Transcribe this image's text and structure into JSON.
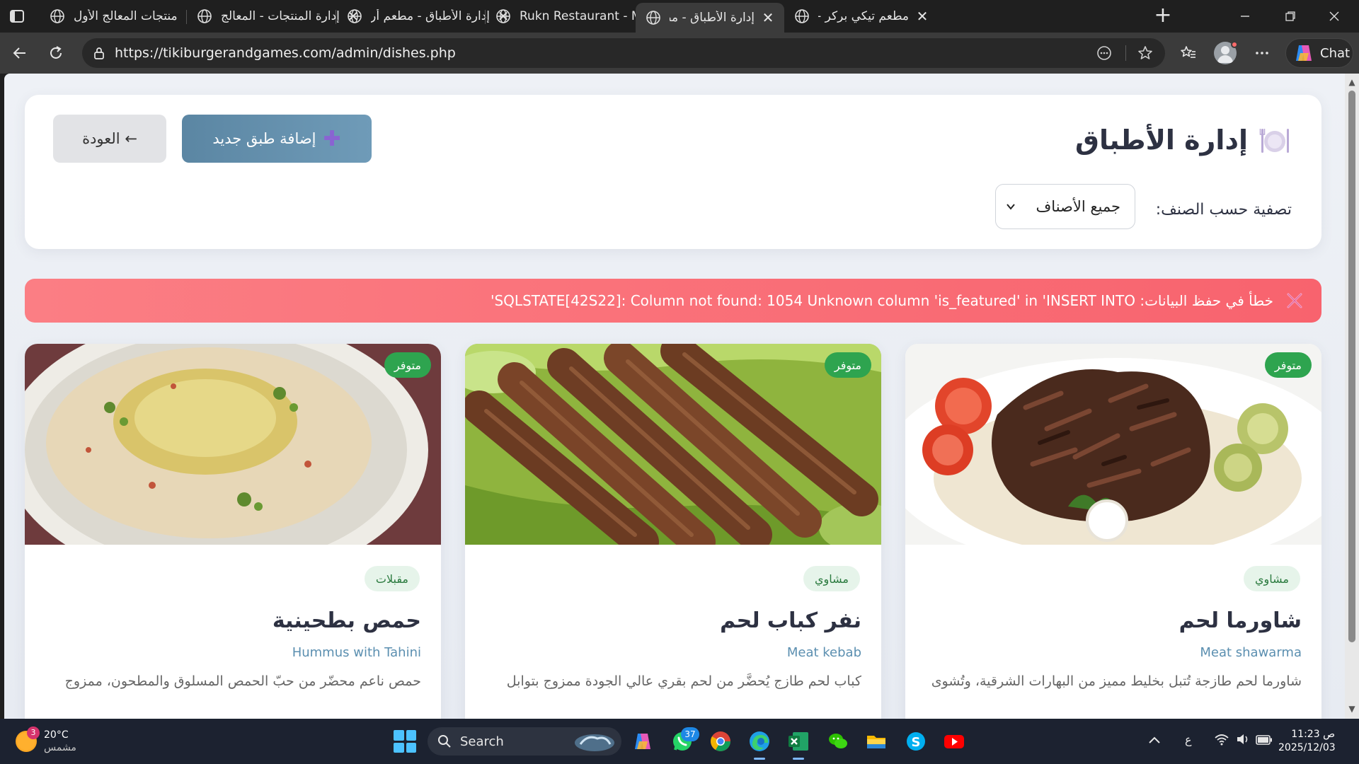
{
  "browser": {
    "tabs": [
      {
        "title": "منتجات المعالج الأول",
        "active": false
      },
      {
        "title": "إدارة المنتجات - المعالج",
        "active": false
      },
      {
        "title": "إدارة الأطباق - مطعم أرز",
        "active": false
      },
      {
        "title": "Rukn Restaurant - Menu",
        "active": false
      },
      {
        "title": "إدارة الأطباق - مطعم أرز",
        "active": true
      },
      {
        "title": "مطعم تيكي بركر - Menu",
        "active": false
      }
    ],
    "url": "https://tikiburgerandgames.com/admin/dishes.php",
    "chat_label": "Chat"
  },
  "page": {
    "title": "إدارة الأطباق",
    "add_button": "إضافة طبق جديد",
    "back_button": "← العودة",
    "filter_label": "تصفية حسب الصنف:",
    "filter_value": "جميع الأصناف",
    "error_message": "خطأ في حفظ البيانات: SQLSTATE[42S22]: Column not found: 1054 Unknown column 'is_featured' in 'INSERT INTO'"
  },
  "dishes": [
    {
      "status": "متوفر",
      "category": "مشاوي",
      "name": "شاورما لحم",
      "name_en": "Meat shawarma",
      "description": "شاورما لحم طازجة تُتبل بخليط مميز من البهارات الشرقية، وتُشوى",
      "image": "shawarma-plate"
    },
    {
      "status": "متوفر",
      "category": "مشاوي",
      "name": "نفر كباب لحم",
      "name_en": "Meat kebab",
      "description": "كباب لحم طازج يُحضَّر من لحم بقري عالي الجودة ممزوج بتوابل",
      "image": "kebab-skewers"
    },
    {
      "status": "متوفر",
      "category": "مقبلات",
      "name": "حمص بطحينية",
      "name_en": "Hummus with Tahini",
      "description": "حمص ناعم محضّر من حبّ الحمص المسلوق والمطحون، ممزوج",
      "image": "hummus-bowl"
    }
  ],
  "taskbar": {
    "weather_temp": "20°C",
    "weather_desc": "مشمس",
    "weather_badge": "3",
    "search_label": "Search",
    "whatsapp_badge": "37",
    "lang": "ع",
    "time": "11:23 ص",
    "date": "2025/12/03"
  }
}
